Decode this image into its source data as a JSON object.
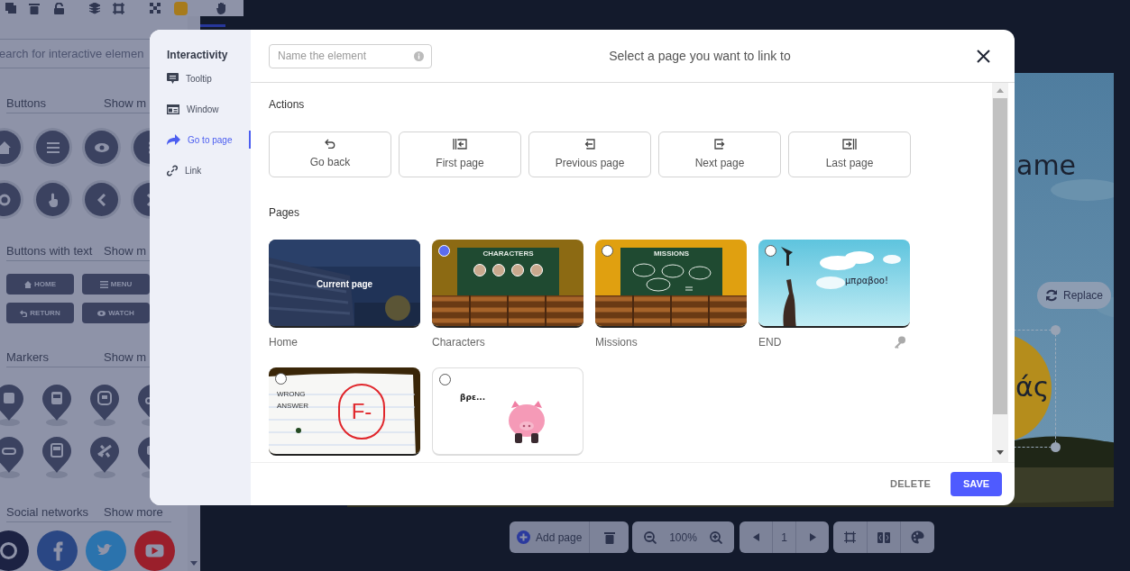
{
  "element_panel": {
    "search": {
      "placeholder": "earch for interactive elemen"
    },
    "sections": [
      {
        "title": "Buttons",
        "more": "Show m",
        "kind": "icons"
      },
      {
        "title": "Buttons with text",
        "more": "Show m",
        "kind": "text_buttons",
        "items": [
          "HOME",
          "MENU",
          "RETURN",
          "WATCH"
        ]
      },
      {
        "title": "Markers",
        "more": "Show m",
        "kind": "markers"
      },
      {
        "title": "Social networks",
        "more": "Show more",
        "kind": "social"
      }
    ]
  },
  "canvas": {
    "heading": "ame",
    "circle_text": "άς",
    "replace_button": "Replace"
  },
  "modal": {
    "sidebar": {
      "title": "Interactivity",
      "items": [
        {
          "label": "Tooltip",
          "kind": "tooltip",
          "selected": false
        },
        {
          "label": "Window",
          "kind": "window",
          "selected": false
        },
        {
          "label": "Go to page",
          "kind": "goto",
          "selected": true
        },
        {
          "label": "Link",
          "kind": "link",
          "selected": false
        }
      ]
    },
    "name_field": {
      "placeholder": "Name the element"
    },
    "title": "Select a page you want to link to",
    "actions": {
      "label": "Actions",
      "buttons": [
        {
          "label": "Go back",
          "kind": "back"
        },
        {
          "label": "First page",
          "kind": "first"
        },
        {
          "label": "Previous page",
          "kind": "previous"
        },
        {
          "label": "Next page",
          "kind": "next"
        },
        {
          "label": "Last page",
          "kind": "last"
        }
      ]
    },
    "pages": {
      "label": "Pages",
      "items": [
        {
          "name": "Home",
          "kind": "school",
          "current": true,
          "badge": "Current page",
          "key": false
        },
        {
          "name": "Characters",
          "kind": "classroom",
          "current": false,
          "selected": true,
          "texts": [
            "CHARACTERS"
          ],
          "key": false
        },
        {
          "name": "Missions",
          "kind": "classroom",
          "current": false,
          "selected": false,
          "texts": [
            "MISSIONS"
          ],
          "key": false
        },
        {
          "name": "END",
          "kind": "sky",
          "current": false,
          "selected": false,
          "texts": [
            "μπραβοο!"
          ],
          "key": true
        },
        {
          "kind": "note",
          "current": false,
          "selected": false,
          "texts": [
            "WRONG",
            "ANSWER",
            "F-"
          ],
          "key": false
        },
        {
          "kind": "pig",
          "current": false,
          "selected": false,
          "texts": [
            "βρε..."
          ],
          "key": false
        }
      ]
    },
    "footer": {
      "delete": "DELETE",
      "save": "SAVE"
    }
  },
  "bottom_toolbar": {
    "add_page": "Add page",
    "zoom": "100%",
    "page": "1"
  }
}
